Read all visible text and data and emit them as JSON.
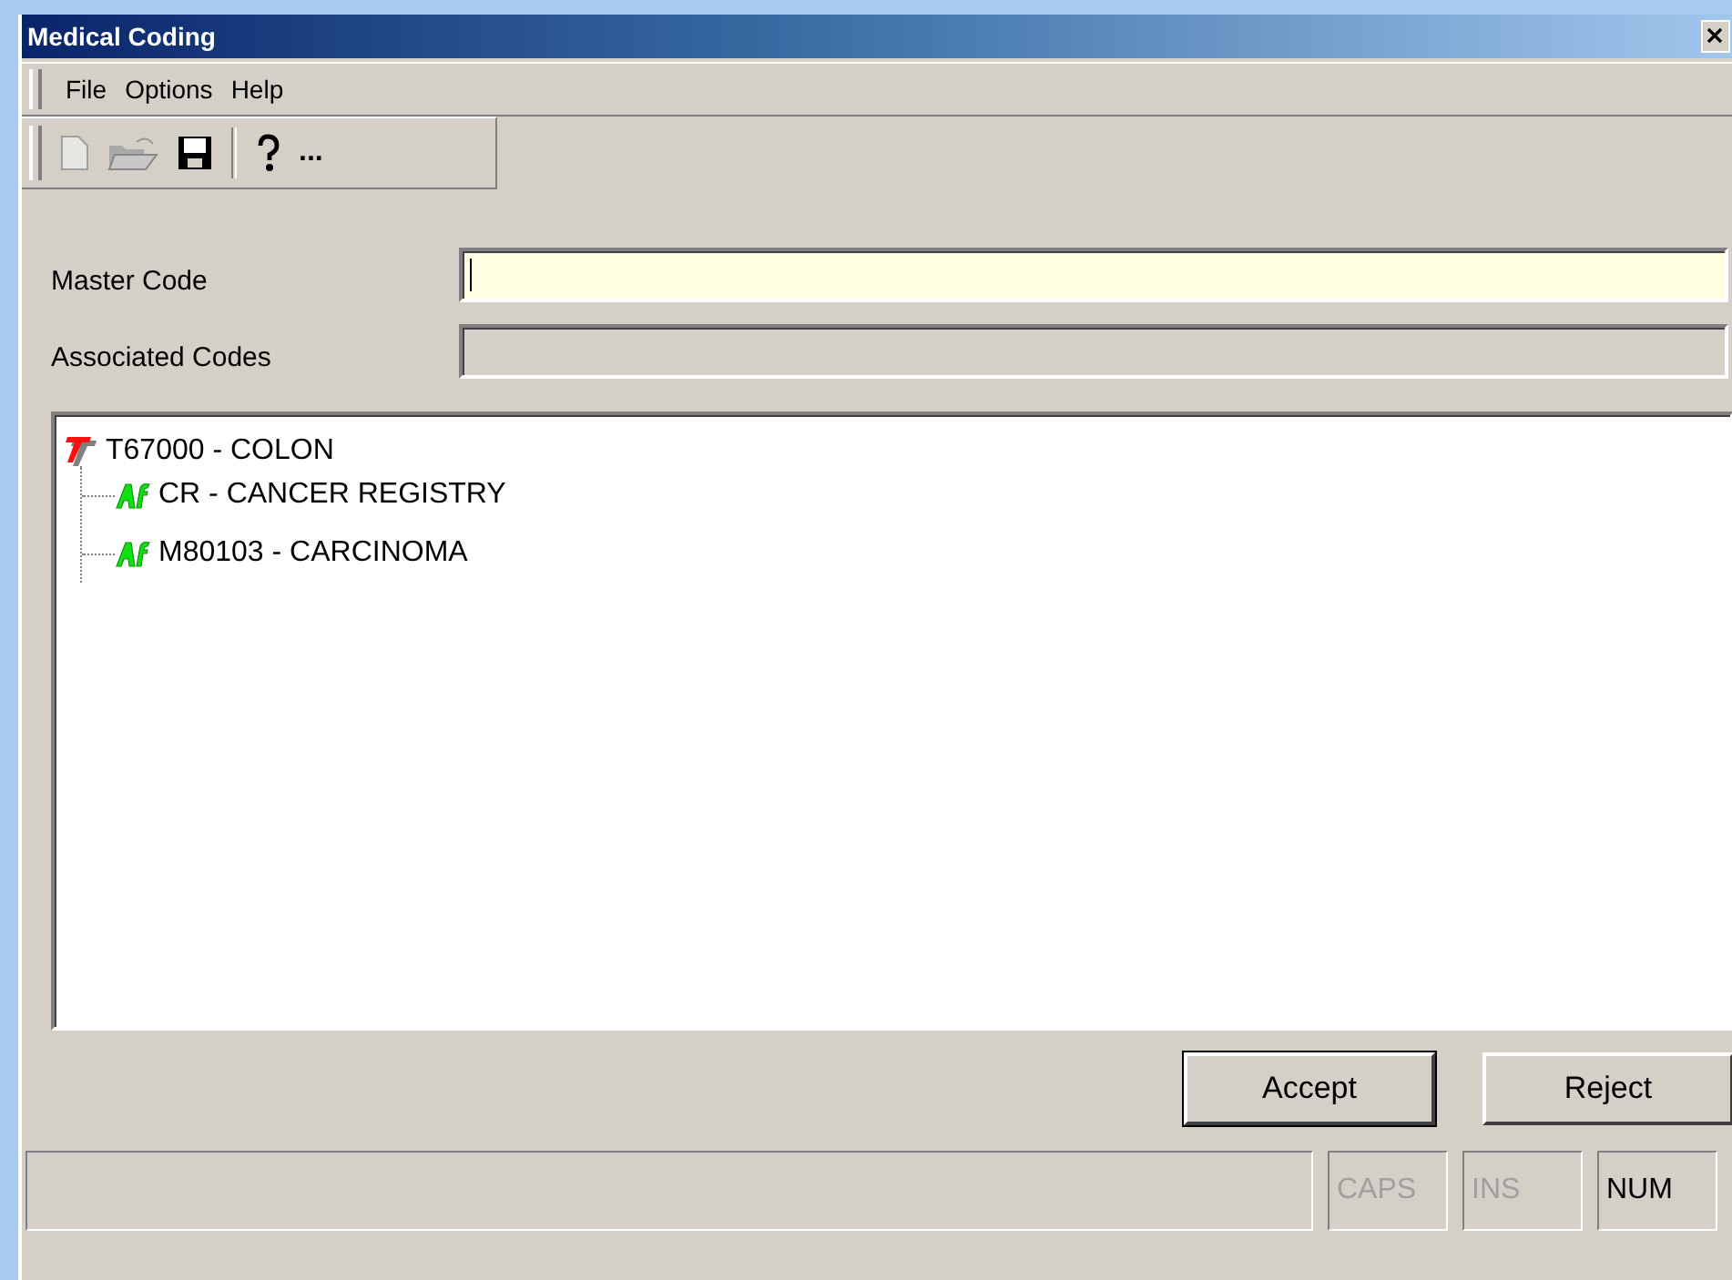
{
  "window": {
    "title": "Medical Coding"
  },
  "menu": [
    "File",
    "Options",
    "Help"
  ],
  "toolbar": [
    {
      "kind": "new",
      "disabled": true
    },
    {
      "kind": "open",
      "disabled": true
    },
    {
      "kind": "save",
      "disabled": false
    },
    {
      "kind": "separator"
    },
    {
      "kind": "help",
      "disabled": false
    },
    {
      "kind": "more",
      "label": "...",
      "disabled": false
    }
  ],
  "fields": [
    {
      "label": "Master Code",
      "disabled": false,
      "focused": true
    },
    {
      "label": "Associated Codes",
      "disabled": true,
      "focused": false
    }
  ],
  "tree": [
    {
      "label": "T67000 - COLON",
      "kind": "topography",
      "children": [
        {
          "label": "CR - CANCER REGISTRY",
          "kind": "association"
        },
        {
          "label": "M80103 - CARCINOMA",
          "kind": "association"
        }
      ]
    }
  ],
  "buttons": [
    {
      "label": "Accept",
      "default": true
    },
    {
      "label": "Reject",
      "default": false
    }
  ],
  "status_bar": {
    "indicators": [
      {
        "label": "CAPS",
        "on": false
      },
      {
        "label": "INS",
        "on": false
      },
      {
        "label": "NUM",
        "on": true
      }
    ]
  }
}
